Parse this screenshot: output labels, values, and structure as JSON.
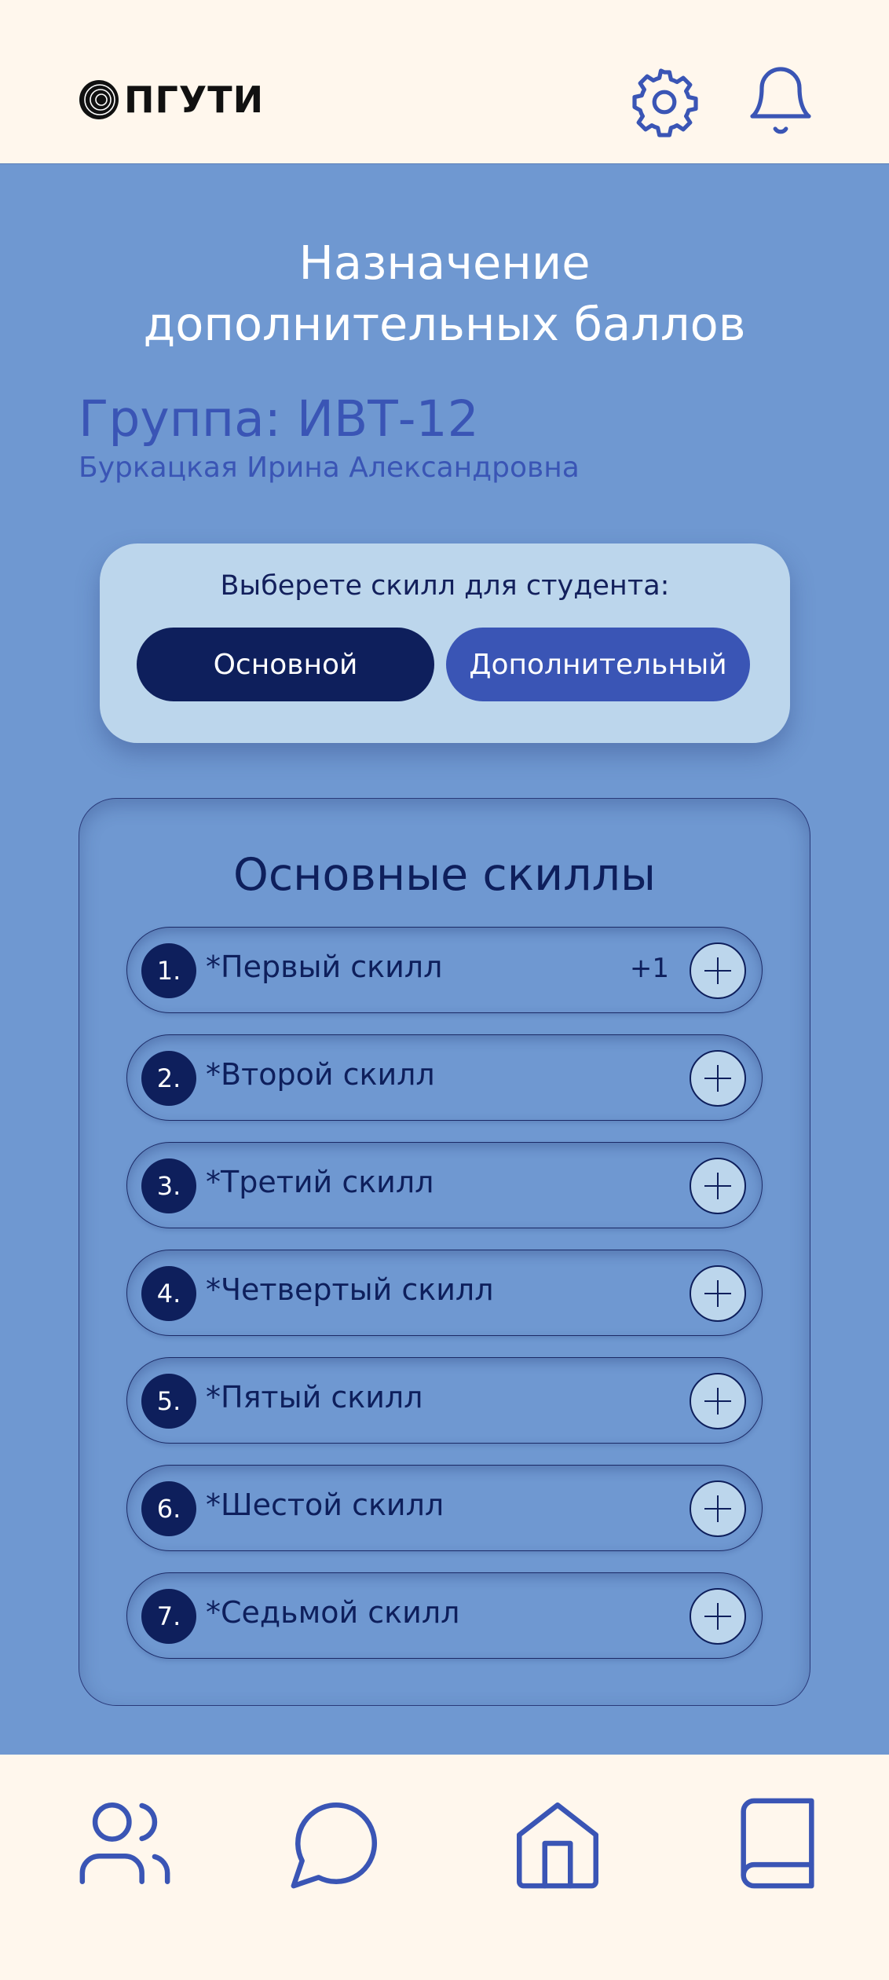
{
  "header": {
    "logo_text": "ПГУТИ",
    "icons": [
      "settings-gear-icon",
      "notification-bell-icon"
    ]
  },
  "page": {
    "title_line1": "Назначение",
    "title_line2": "дополнительных баллов",
    "group": "Группа: ИВТ-12",
    "teacher": "Буркацкая Ирина Александровна"
  },
  "chooser": {
    "label": "Выберете скилл для студента:",
    "main_label": "Основной",
    "extra_label": "Дополнительный"
  },
  "skills_panel": {
    "title": "Основные скиллы",
    "items": [
      {
        "num": "1.",
        "name": "*Первый скилл",
        "points": "+1"
      },
      {
        "num": "2.",
        "name": "*Второй скилл",
        "points": ""
      },
      {
        "num": "3.",
        "name": "*Третий скилл",
        "points": ""
      },
      {
        "num": "4.",
        "name": "*Четвертый скилл",
        "points": ""
      },
      {
        "num": "5.",
        "name": "*Пятый скилл",
        "points": ""
      },
      {
        "num": "6.",
        "name": "*Шестой скилл",
        "points": ""
      },
      {
        "num": "7.",
        "name": "*Седьмой скилл",
        "points": ""
      }
    ]
  },
  "bottom_nav": {
    "icons": [
      "users-icon",
      "chat-icon",
      "home-icon",
      "book-icon"
    ]
  },
  "colors": {
    "background": "#6f98d1",
    "bar": "#fff7ed",
    "navy": "#0e1f5c",
    "accent": "#3a55b5",
    "light_blue": "#bcd6ec"
  }
}
